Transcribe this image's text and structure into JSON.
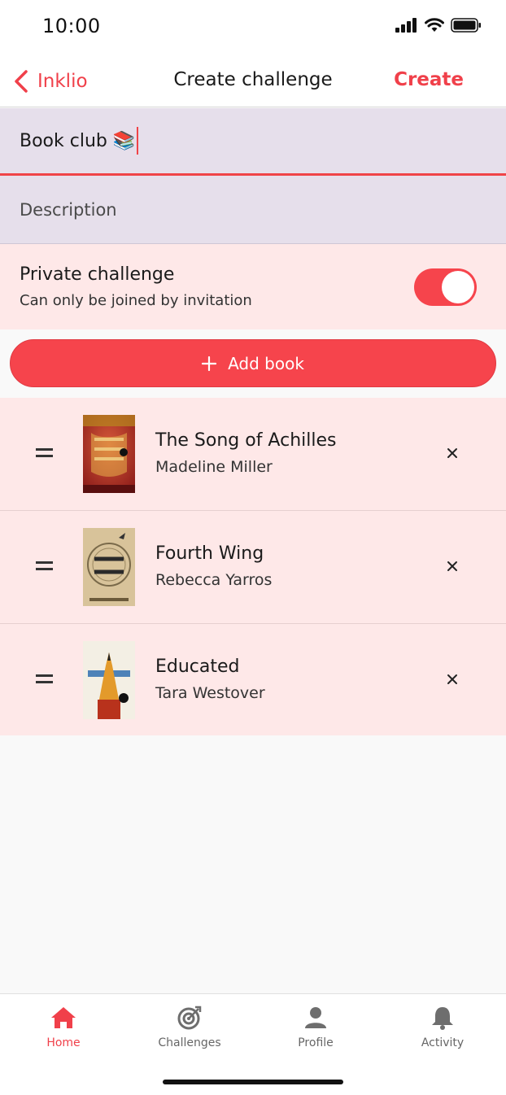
{
  "status_bar": {
    "time": "10:00"
  },
  "nav": {
    "back_label": "Inklio",
    "title": "Create challenge",
    "create_label": "Create"
  },
  "form": {
    "title_value": "Book club 📚",
    "description_placeholder": "Description",
    "private_title": "Private challenge",
    "private_subtitle": "Can only be joined by invitation",
    "private_enabled": true
  },
  "add_book_label": "Add book",
  "books": [
    {
      "title": "The Song of Achilles",
      "author": "Madeline Miller"
    },
    {
      "title": "Fourth Wing",
      "author": "Rebecca Yarros"
    },
    {
      "title": "Educated",
      "author": "Tara Westover"
    }
  ],
  "tabs": [
    {
      "label": "Home",
      "icon": "home-icon",
      "active": true
    },
    {
      "label": "Challenges",
      "icon": "target-icon",
      "active": false
    },
    {
      "label": "Profile",
      "icon": "person-icon",
      "active": false
    },
    {
      "label": "Activity",
      "icon": "bell-icon",
      "active": false
    }
  ],
  "colors": {
    "accent": "#f0404a",
    "field_bg": "#e6dfeb",
    "row_bg": "#fee8e8"
  }
}
